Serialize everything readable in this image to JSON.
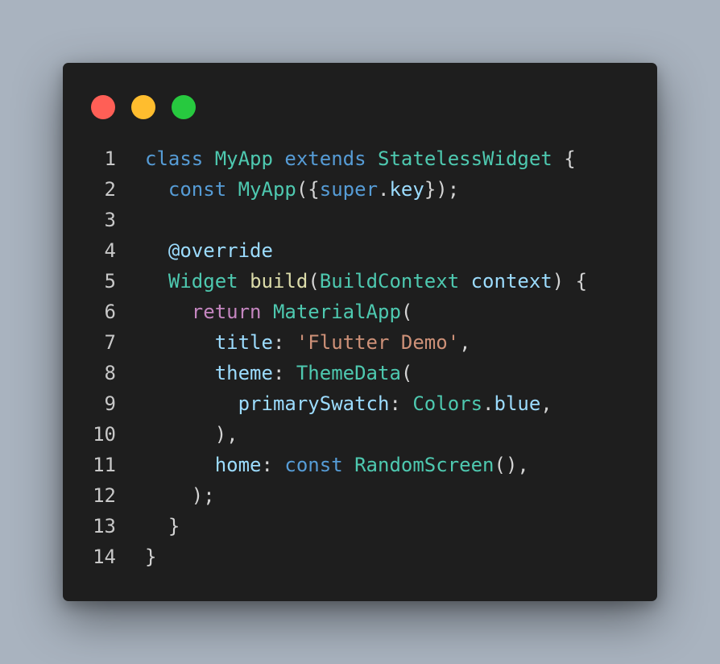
{
  "colors": {
    "background": "#a9b3bf",
    "window": "#1e1e1e",
    "close": "#ff5f56",
    "minimize": "#ffbd2e",
    "maximize": "#27c93f",
    "line_number": "#c8c8c8",
    "keyword": "#569cd6",
    "type": "#4ec9b0",
    "function": "#dcdcaa",
    "variable": "#9cdcfe",
    "string": "#ce9178",
    "control": "#c586c0",
    "punctuation": "#d4d4d4"
  },
  "window_controls": [
    {
      "name": "close-button",
      "color": "#ff5f56"
    },
    {
      "name": "minimize-button",
      "color": "#ffbd2e"
    },
    {
      "name": "maximize-button",
      "color": "#27c93f"
    }
  ],
  "code": {
    "language": "dart",
    "lines": [
      {
        "number": "1",
        "tokens": [
          {
            "text": "class",
            "type": "keyword"
          },
          {
            "text": " ",
            "type": "punct"
          },
          {
            "text": "MyApp",
            "type": "type"
          },
          {
            "text": " ",
            "type": "punct"
          },
          {
            "text": "extends",
            "type": "keyword"
          },
          {
            "text": " ",
            "type": "punct"
          },
          {
            "text": "StatelessWidget",
            "type": "type"
          },
          {
            "text": " {",
            "type": "punct"
          }
        ]
      },
      {
        "number": "2",
        "tokens": [
          {
            "text": "  ",
            "type": "punct"
          },
          {
            "text": "const",
            "type": "keyword"
          },
          {
            "text": " ",
            "type": "punct"
          },
          {
            "text": "MyApp",
            "type": "type"
          },
          {
            "text": "({",
            "type": "punct"
          },
          {
            "text": "super",
            "type": "keyword"
          },
          {
            "text": ".",
            "type": "punct"
          },
          {
            "text": "key",
            "type": "variable"
          },
          {
            "text": "});",
            "type": "punct"
          }
        ]
      },
      {
        "number": "3",
        "tokens": []
      },
      {
        "number": "4",
        "tokens": [
          {
            "text": "  ",
            "type": "punct"
          },
          {
            "text": "@override",
            "type": "variable"
          }
        ]
      },
      {
        "number": "5",
        "tokens": [
          {
            "text": "  ",
            "type": "punct"
          },
          {
            "text": "Widget",
            "type": "type"
          },
          {
            "text": " ",
            "type": "punct"
          },
          {
            "text": "build",
            "type": "function"
          },
          {
            "text": "(",
            "type": "punct"
          },
          {
            "text": "BuildContext",
            "type": "type"
          },
          {
            "text": " ",
            "type": "punct"
          },
          {
            "text": "context",
            "type": "variable"
          },
          {
            "text": ") {",
            "type": "punct"
          }
        ]
      },
      {
        "number": "6",
        "tokens": [
          {
            "text": "    ",
            "type": "punct"
          },
          {
            "text": "return",
            "type": "control"
          },
          {
            "text": " ",
            "type": "punct"
          },
          {
            "text": "MaterialApp",
            "type": "type"
          },
          {
            "text": "(",
            "type": "punct"
          }
        ]
      },
      {
        "number": "7",
        "tokens": [
          {
            "text": "      ",
            "type": "punct"
          },
          {
            "text": "title",
            "type": "variable"
          },
          {
            "text": ": ",
            "type": "punct"
          },
          {
            "text": "'Flutter Demo'",
            "type": "string"
          },
          {
            "text": ",",
            "type": "punct"
          }
        ]
      },
      {
        "number": "8",
        "tokens": [
          {
            "text": "      ",
            "type": "punct"
          },
          {
            "text": "theme",
            "type": "variable"
          },
          {
            "text": ": ",
            "type": "punct"
          },
          {
            "text": "ThemeData",
            "type": "type"
          },
          {
            "text": "(",
            "type": "punct"
          }
        ]
      },
      {
        "number": "9",
        "tokens": [
          {
            "text": "        ",
            "type": "punct"
          },
          {
            "text": "primarySwatch",
            "type": "variable"
          },
          {
            "text": ": ",
            "type": "punct"
          },
          {
            "text": "Colors",
            "type": "type"
          },
          {
            "text": ".",
            "type": "punct"
          },
          {
            "text": "blue",
            "type": "variable"
          },
          {
            "text": ",",
            "type": "punct"
          }
        ]
      },
      {
        "number": "10",
        "tokens": [
          {
            "text": "      ),",
            "type": "punct"
          }
        ]
      },
      {
        "number": "11",
        "tokens": [
          {
            "text": "      ",
            "type": "punct"
          },
          {
            "text": "home",
            "type": "variable"
          },
          {
            "text": ": ",
            "type": "punct"
          },
          {
            "text": "const",
            "type": "keyword"
          },
          {
            "text": " ",
            "type": "punct"
          },
          {
            "text": "RandomScreen",
            "type": "type"
          },
          {
            "text": "(),",
            "type": "punct"
          }
        ]
      },
      {
        "number": "12",
        "tokens": [
          {
            "text": "    );",
            "type": "punct"
          }
        ]
      },
      {
        "number": "13",
        "tokens": [
          {
            "text": "  }",
            "type": "punct"
          }
        ]
      },
      {
        "number": "14",
        "tokens": [
          {
            "text": "}",
            "type": "punct"
          }
        ]
      }
    ]
  }
}
